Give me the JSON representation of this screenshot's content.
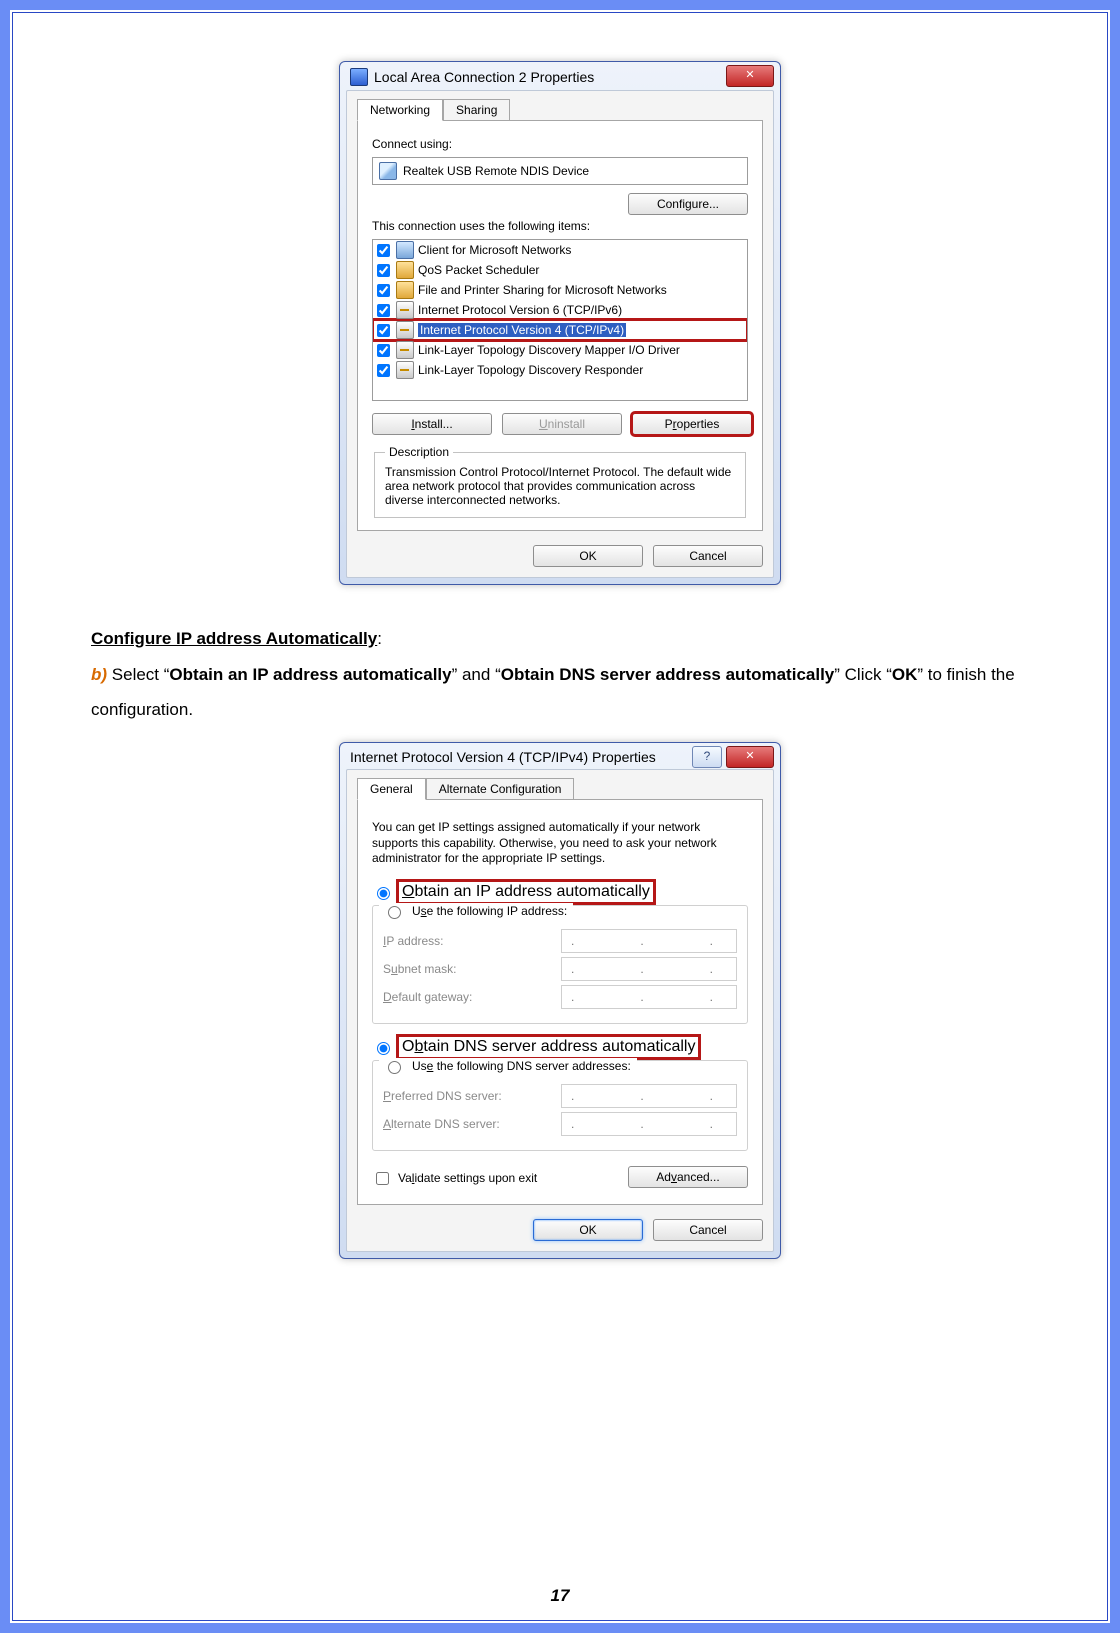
{
  "page_number": "17",
  "dialog1": {
    "title": "Local Area Connection 2 Properties",
    "close_glyph": "✕",
    "tabs": {
      "networking": "Networking",
      "sharing": "Sharing"
    },
    "connect_using_label": "Connect using:",
    "adapter": "Realtek USB Remote NDIS Device",
    "configure_btn": "Configure...",
    "uses_label": "This connection uses the following items:",
    "items": [
      "Client for Microsoft Networks",
      "QoS Packet Scheduler",
      "File and Printer Sharing for Microsoft Networks",
      "Internet Protocol Version 6 (TCP/IPv6)",
      "Internet Protocol Version 4 (TCP/IPv4)",
      "Link-Layer Topology Discovery Mapper I/O Driver",
      "Link-Layer Topology Discovery Responder"
    ],
    "install_btn": "Install...",
    "uninstall_btn": "Uninstall",
    "properties_btn": "Properties",
    "description_legend": "Description",
    "description_text": "Transmission Control Protocol/Internet Protocol. The default wide area network protocol that provides communication across diverse interconnected networks.",
    "ok_btn": "OK",
    "cancel_btn": "Cancel"
  },
  "instruction": {
    "heading": "Configure IP address Automatically",
    "colon": ":",
    "b_tag": "b)",
    "p1a": "Select “",
    "p1b": "Obtain an IP address automatically",
    "p1c": "” and “",
    "p1d": "Obtain DNS server address automatically",
    "p1e": "” Click “",
    "p1f": "OK",
    "p1g": "” to finish the configuration."
  },
  "dialog2": {
    "title": "Internet Protocol Version 4 (TCP/IPv4) Properties",
    "help_glyph": "?",
    "close_glyph": "✕",
    "tabs": {
      "general": "General",
      "alt": "Alternate Configuration"
    },
    "info": "You can get IP settings assigned automatically if your network supports this capability. Otherwise, you need to ask your network administrator for the appropriate IP settings.",
    "ip_auto": "Obtain an IP address automatically",
    "ip_manual_pre": "Use the following IP address:",
    "ip_address": "IP address:",
    "subnet": "Subnet mask:",
    "gateway": "Default gateway:",
    "dns_auto": "Obtain DNS server address automatically",
    "dns_manual_pre": "Use the following DNS server addresses:",
    "pref_dns": "Preferred DNS server:",
    "alt_dns": "Alternate DNS server:",
    "validate": "Validate settings upon exit",
    "advanced_btn": "Advanced...",
    "ok_btn": "OK",
    "cancel_btn": "Cancel",
    "ip_placeholder": ".   .   ."
  }
}
